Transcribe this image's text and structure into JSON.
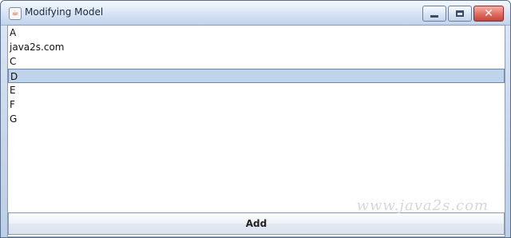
{
  "window": {
    "title": "Modifying Model"
  },
  "list": {
    "items": [
      "A",
      "java2s.com",
      "C",
      "D",
      "E",
      "F",
      "G"
    ],
    "selected_item": "D"
  },
  "buttons": {
    "add_label": "Add"
  },
  "watermark": "www.java2s.com",
  "icons": {
    "app": "java-icon",
    "minimize": "minimize-icon",
    "maximize": "maximize-icon",
    "close": "close-icon"
  },
  "colors": {
    "selection": "#bfd3ea",
    "close_button": "#d8574a"
  }
}
